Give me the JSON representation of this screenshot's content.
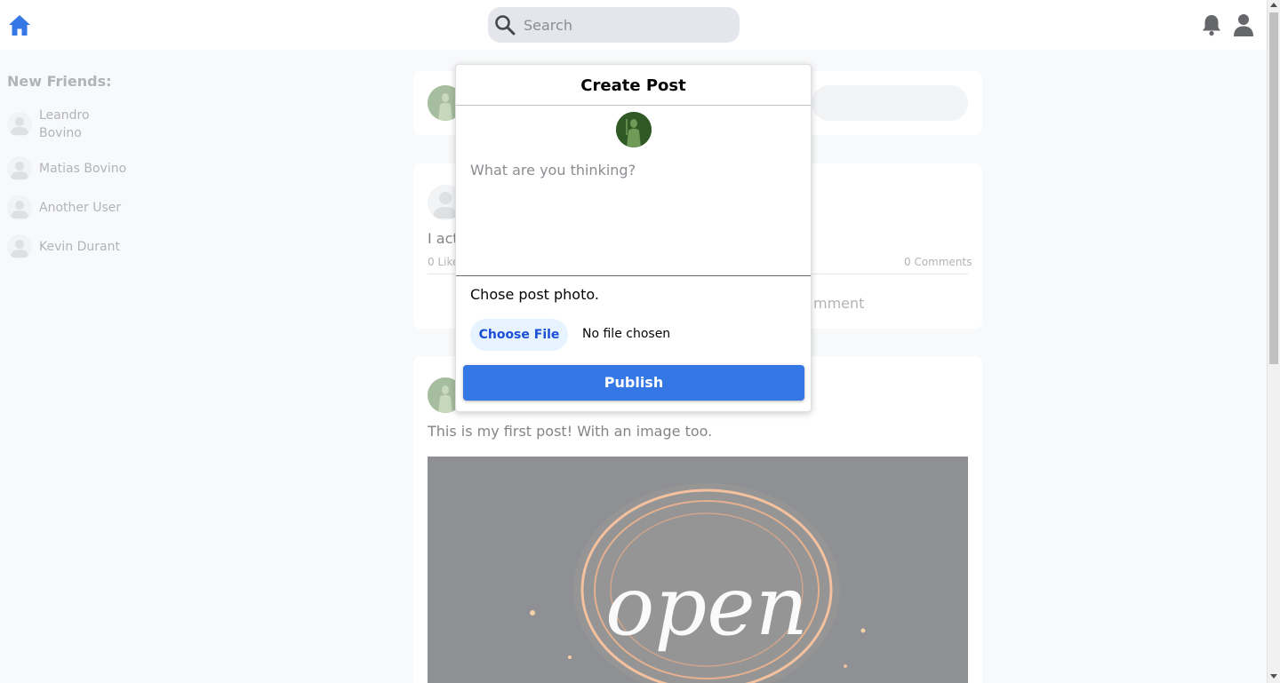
{
  "header": {
    "search_placeholder": "Search",
    "icons": [
      "home-icon",
      "search-icon",
      "bell-icon",
      "user-icon"
    ],
    "accent_color": "#3578e5"
  },
  "sidebar": {
    "title": "New Friends:",
    "friends": [
      {
        "name": "Leandro Bovino"
      },
      {
        "name": "Matias Bovino"
      },
      {
        "name": "Another User"
      },
      {
        "name": "Kevin Durant"
      }
    ]
  },
  "feed": {
    "post1": {
      "text_visible": "I act",
      "likes": "0 Like",
      "comments": "0 Comments",
      "comment_action": "mment"
    },
    "post2": {
      "text": "This is my first post! With an image too.",
      "image_word": "open"
    }
  },
  "modal": {
    "title": "Create Post",
    "textarea_placeholder": "What are you thinking?",
    "photo_label": "Chose post photo.",
    "choose_file_label": "Choose File",
    "no_file_text": "No file chosen",
    "publish_label": "Publish"
  }
}
